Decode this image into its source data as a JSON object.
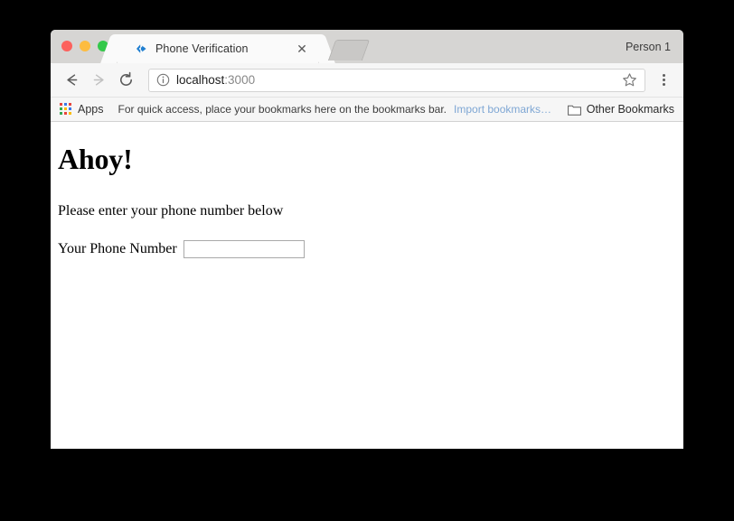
{
  "window": {
    "traffic_lights": [
      {
        "name": "close",
        "color": "#fc615d"
      },
      {
        "name": "minimize",
        "color": "#fdbc40"
      },
      {
        "name": "maximize",
        "color": "#34c84a"
      }
    ]
  },
  "tabs": [
    {
      "title": "Phone Verification",
      "favicon": "blue-diamond-arrow-icon",
      "close_label": "✕",
      "active": true
    }
  ],
  "new_tab": {
    "label": ""
  },
  "profile": {
    "label": "Person 1"
  },
  "toolbar": {
    "back_label": "←",
    "forward_label": "→",
    "reload_label": "⟳",
    "info_icon": "page-info-icon",
    "url_host": "localhost",
    "url_port": ":3000",
    "url_full": "localhost:3000",
    "star_icon": "bookmark-star-icon",
    "menu_icon": "three-dot-menu-icon"
  },
  "bookmarks_bar": {
    "apps_label": "Apps",
    "apps_icon": "apps-grid-icon",
    "apps_colors": [
      "#e8453c",
      "#3b78e7",
      "#e8453c",
      "#34a853",
      "#fbbc05",
      "#3b78e7",
      "#34a853",
      "#e8453c",
      "#fbbc05"
    ],
    "hint_text": "For quick access, place your bookmarks here on the bookmarks bar.",
    "import_link": "Import bookmarks…",
    "other_bookmarks_label": "Other Bookmarks",
    "folder_icon": "folder-icon"
  },
  "page": {
    "heading": "Ahoy!",
    "paragraph": "Please enter your phone number below",
    "form": {
      "field_label": "Your Phone Number",
      "input_value": "",
      "input_placeholder": ""
    }
  },
  "colors": {
    "accent_blue": "#1f7ed0",
    "link_blue": "#7fa7d4",
    "page_background": "#ffffff",
    "desktop_background": "#000000",
    "chrome_tabstrip": "#d6d5d3",
    "chrome_toolbar": "#f6f6f6"
  }
}
